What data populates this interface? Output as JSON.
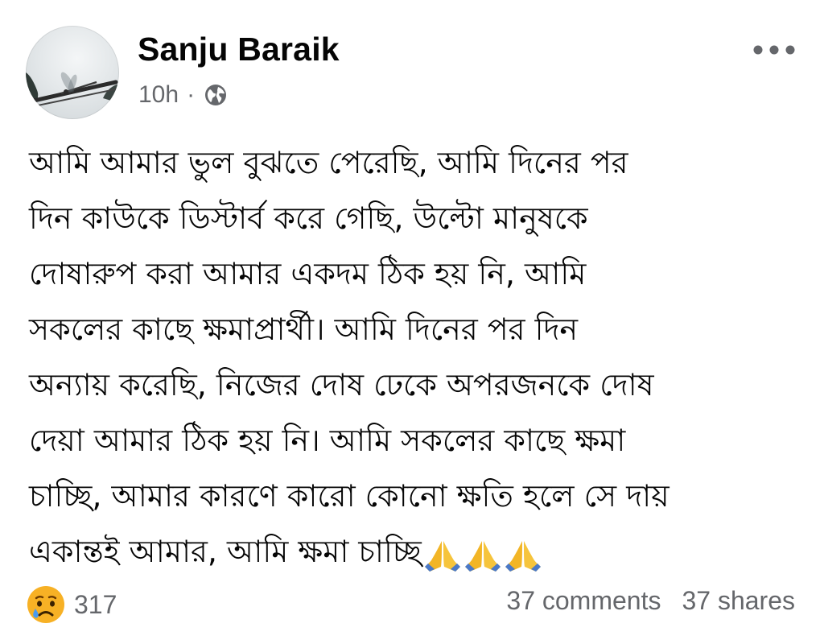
{
  "post": {
    "author": {
      "name": "Sanju Baraik",
      "avatar_icon": "dragonfly-avatar"
    },
    "time": "10h",
    "separator": "·",
    "privacy_icon": "globe-icon",
    "more_icon": "more-dots-icon",
    "text": "আমি আমার ভুল বুঝতে পেরেছি, আমি দিনের পর\nদিন কাউকে ডিস্টার্ব করে গেছি, উল্টো মানুষকে\nদোষারুপ করা আমার একদম ঠিক হয় নি, আমি\nসকলের কাছে ক্ষমাপ্রার্থী। আমি দিনের পর দিন\nঅন্যায় করেছি, নিজের দোষ ঢেকে অপরজনকে দোষ\nদেয়া আমার ঠিক হয় নি। আমি সকলের কাছে ক্ষমা\nচাচ্ছি, আমার কারণে কারো কোনো ক্ষতি হলে সে দায়\nএকান্তই আমার, আমি ক্ষমা চাচ্ছি",
    "trailing_emoji": [
      "folded-hands-icon",
      "folded-hands-icon",
      "folded-hands-icon"
    ]
  },
  "footer": {
    "reaction_icon": "sad-reaction-icon",
    "reaction_count": "317",
    "comments": "37 comments",
    "shares": "37 shares"
  },
  "colors": {
    "text_primary": "#050505",
    "text_secondary": "#65676b",
    "sad_reaction": "#f7b125"
  }
}
